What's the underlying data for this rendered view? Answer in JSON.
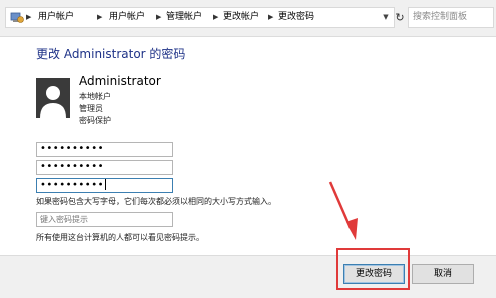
{
  "breadcrumb": {
    "items": [
      "用户帐户",
      "用户帐户",
      "管理帐户",
      "更改帐户",
      "更改密码"
    ]
  },
  "search": {
    "placeholder": "搜索控制面板"
  },
  "page": {
    "title": "更改 Administrator 的密码"
  },
  "user": {
    "name": "Administrator",
    "account_type": "本地帐户",
    "role": "管理员",
    "protection": "密码保护"
  },
  "form": {
    "current_password_mask": "••••••••••",
    "new_password_mask": "••••••••••",
    "confirm_password_mask": "••••••••••",
    "case_note": "如果密码包含大写字母，它们每次都必须以相同的大小写方式输入。",
    "hint_placeholder": "键入密码提示",
    "hint_note": "所有使用这台计算机的人都可以看见密码提示。"
  },
  "footer": {
    "change_button": "更改密码",
    "cancel_button": "取消"
  },
  "colors": {
    "title": "#1e3287",
    "annotation": "#e03a3a",
    "focus_border": "#3c7fb1"
  },
  "icons": {
    "address_icon": "control-panel-icon",
    "avatar": "user-avatar-silhouette",
    "refresh": "refresh-icon",
    "dropdown": "chevron-down-icon"
  }
}
